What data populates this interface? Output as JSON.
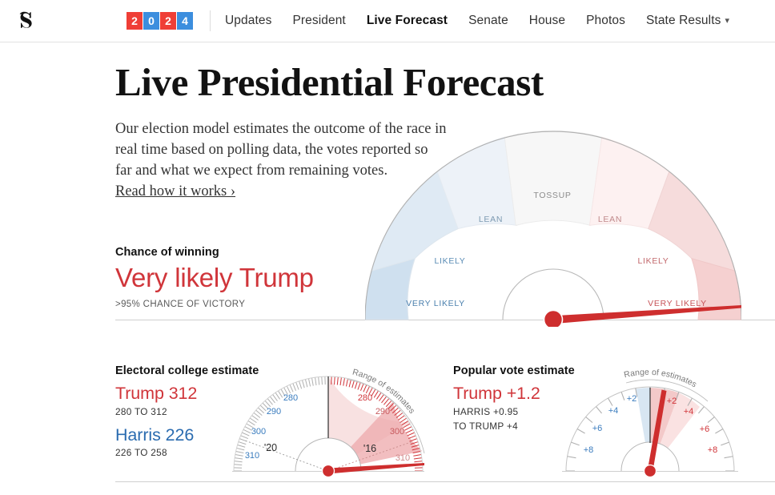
{
  "nav": {
    "logo_alt": "The New York Times",
    "year_badge": [
      "2",
      "0",
      "2",
      "4"
    ],
    "links": [
      {
        "label": "Updates",
        "active": false
      },
      {
        "label": "President",
        "active": false
      },
      {
        "label": "Live Forecast",
        "active": true
      },
      {
        "label": "Senate",
        "active": false
      },
      {
        "label": "House",
        "active": false
      },
      {
        "label": "Photos",
        "active": false
      },
      {
        "label": "State Results",
        "active": false,
        "has_menu": true
      }
    ],
    "chevron": "⌄"
  },
  "header": {
    "title": "Live Presidential Forecast",
    "deck_line1": "Our election model estimates the outcome of the race in",
    "deck_line2": "real time based on polling data, the votes reported so",
    "deck_line3": "far and what we expect from remaining votes.",
    "read_more": "Read how it works ›"
  },
  "chance": {
    "label": "Chance of winning",
    "value": "Very likely Trump",
    "sub": ">95% CHANCE OF VICTORY"
  },
  "colors": {
    "rep": "#d0353a",
    "dem": "#2b6cb0",
    "rep_badge": "#ef3e36",
    "dem_badge": "#3c8ede",
    "tossup_text": "#8c8c8c",
    "needle": "#ce2e2e",
    "axis": "#9a9a9a"
  },
  "electoral": {
    "title": "Electoral college estimate",
    "leader": "Trump 312",
    "leader_range": "280 TO 312",
    "trailer": "Harris 226",
    "trailer_range": "226 TO 258",
    "range_label": "Range of estimates",
    "ticks_dem": [
      "280",
      "290",
      "300",
      "310"
    ],
    "ticks_rep": [
      "280",
      "290",
      "300",
      "310"
    ],
    "marker_prev": "'20",
    "marker_prev2": "'16"
  },
  "popular": {
    "title": "Popular vote estimate",
    "leader": "Trump +1.2",
    "range_line1": "HARRIS +0.95",
    "range_line2": "TO TRUMP +4",
    "range_label": "Range of estimates",
    "ticks_dem": [
      "+2",
      "+4",
      "+6",
      "+8"
    ],
    "ticks_rep": [
      "+2",
      "+4",
      "+6",
      "+8"
    ]
  },
  "chart_data": [
    {
      "type": "gauge",
      "name": "chance-of-winning-dial",
      "title": "Chance of winning",
      "segments": [
        {
          "label": "VERY LIKELY",
          "party": "dem",
          "start_deg": 165,
          "end_deg": 180,
          "fill": "#cfe0ef",
          "text": "#4a7fad"
        },
        {
          "label": "LIKELY",
          "party": "dem",
          "start_deg": 128,
          "end_deg": 165,
          "fill": "#dfeaf4",
          "text": "#5a8cb5"
        },
        {
          "label": "LEAN",
          "party": "dem",
          "start_deg": 105,
          "end_deg": 128,
          "fill": "#eef3f9",
          "text": "#7d9ab2"
        },
        {
          "label": "TOSSUP",
          "party": "none",
          "start_deg": 75,
          "end_deg": 105,
          "fill": "#f6f6f6",
          "text": "#8c8c8c"
        },
        {
          "label": "LEAN",
          "party": "rep",
          "start_deg": 52,
          "end_deg": 75,
          "fill": "#fcf0f0",
          "text": "#c08a8c"
        },
        {
          "label": "LIKELY",
          "party": "rep",
          "start_deg": 15,
          "end_deg": 52,
          "fill": "#f6dede",
          "text": "#c2686c"
        },
        {
          "label": "VERY LIKELY",
          "party": "rep",
          "start_deg": 0,
          "end_deg": 15,
          "fill": "#f4cfcf",
          "text": "#c75358"
        }
      ],
      "needle_deg": 3.5,
      "needle_value": ">95% chance Trump",
      "ylabel": "",
      "xlabel": ""
    },
    {
      "type": "gauge",
      "name": "electoral-college-dial",
      "title": "Electoral college estimate",
      "axis_min_label": "310",
      "axis_max_label": "310",
      "tick_labels_dem": [
        "280",
        "290",
        "300",
        "310"
      ],
      "tick_labels_rep": [
        "280",
        "290",
        "300",
        "310"
      ],
      "estimate_rep": 312,
      "estimate_dem": 226,
      "range_rep": [
        280,
        312
      ],
      "range_dem": [
        226,
        258
      ],
      "range_wedge_deg": [
        6,
        60
      ],
      "range_inner_wedge_deg": [
        6,
        32
      ],
      "needle_deg": 5,
      "markers": [
        {
          "label": "'20",
          "deg": 160
        },
        {
          "label": "'16",
          "deg": 20
        }
      ]
    },
    {
      "type": "gauge",
      "name": "popular-vote-dial",
      "title": "Popular vote estimate",
      "tick_labels_dem": [
        "+2",
        "+4",
        "+6",
        "+8"
      ],
      "tick_labels_rep": [
        "+2",
        "+4",
        "+6",
        "+8"
      ],
      "estimate_margin": 1.2,
      "estimate_leader": "Trump",
      "range_low_label": "HARRIS +0.95",
      "range_high_label": "TO TRUMP +4",
      "needle_deg": 79,
      "range_wedge_deg": [
        60,
        97
      ],
      "center_line_deg": 90
    }
  ]
}
